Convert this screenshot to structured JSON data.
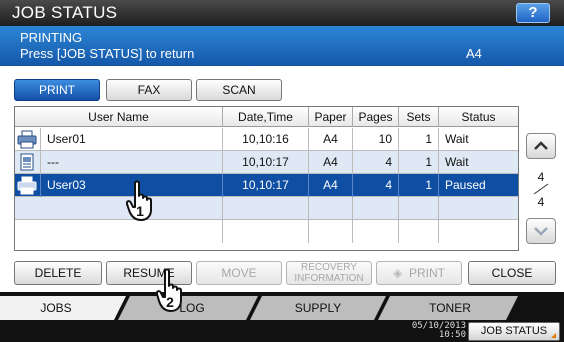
{
  "header": {
    "title": "JOB STATUS",
    "help_label": "?"
  },
  "message": {
    "line1": "PRINTING",
    "line2": "Press [JOB STATUS] to return",
    "paper_size": "A4"
  },
  "job_type_tabs": [
    {
      "label": "PRINT",
      "active": true
    },
    {
      "label": "FAX",
      "active": false
    },
    {
      "label": "SCAN",
      "active": false
    }
  ],
  "table": {
    "columns": [
      "User Name",
      "Date,Time",
      "Paper",
      "Pages",
      "Sets",
      "Status"
    ],
    "rows": [
      {
        "user": "User01",
        "datetime": "10,10:16",
        "paper": "A4",
        "pages": "10",
        "sets": "1",
        "status": "Wait",
        "icon": "printer-icon"
      },
      {
        "user": "---",
        "datetime": "10,10:17",
        "paper": "A4",
        "pages": "4",
        "sets": "1",
        "status": "Wait",
        "icon": "document-icon"
      },
      {
        "user": "User03",
        "datetime": "10,10:17",
        "paper": "A4",
        "pages": "4",
        "sets": "1",
        "status": "Paused",
        "icon": "printer-icon"
      }
    ]
  },
  "pager": {
    "current": "4",
    "total": "4"
  },
  "actions": {
    "delete": "DELETE",
    "resume": "RESUME",
    "move": "MOVE",
    "recovery_line1": "RECOVERY",
    "recovery_line2": "INFORMATION",
    "print": "PRINT",
    "close": "CLOSE"
  },
  "bottom_tabs": {
    "jobs": "JOBS",
    "log": "LOG",
    "supply": "SUPPLY",
    "toner": "TONER"
  },
  "status_bar": {
    "date": "05/10/2013",
    "time": "10:50",
    "job_status": "JOB STATUS"
  },
  "callouts": {
    "first": "1",
    "second": "2"
  },
  "colors": {
    "selected_row": "#0f4fa3",
    "header_blue": "#1f6cc4",
    "title_bar": "#2a2a2a",
    "alt_row": "#dfe9f5"
  }
}
